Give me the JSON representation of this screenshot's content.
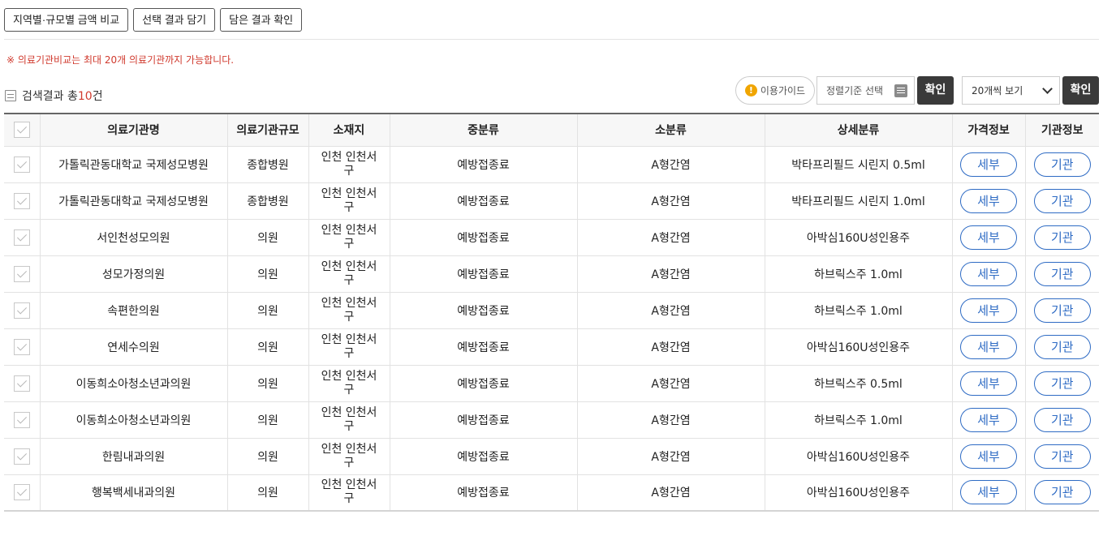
{
  "top_buttons": [
    "지역별·규모별 금액 비교",
    "선택 결과 담기",
    "담은 결과 확인"
  ],
  "notice": "※ 의료기관비교는 최대 20개 의료기관까지 가능합니다.",
  "result": {
    "prefix": "검색결과 총",
    "count": "10",
    "suffix": "건"
  },
  "toolbar": {
    "guide_label": "이용가이드",
    "guide_icon_glyph": "!",
    "sort_placeholder": "정렬기준 선택",
    "confirm_label": "확인",
    "page_size_value": "20개씩 보기"
  },
  "table": {
    "columns": [
      "의료기관명",
      "의료기관규모",
      "소재지",
      "중분류",
      "소분류",
      "상세분류",
      "가격정보",
      "기관정보"
    ],
    "rows": [
      {
        "name": "가톨릭관동대학교 국제성모병원",
        "size": "종합병원",
        "location": "인천 인천서구",
        "mid": "예방접종료",
        "sub": "A형간염",
        "detail": "박타프리필드 시린지 0.5ml",
        "price_btn": "세부",
        "inst_btn": "기관"
      },
      {
        "name": "가톨릭관동대학교 국제성모병원",
        "size": "종합병원",
        "location": "인천 인천서구",
        "mid": "예방접종료",
        "sub": "A형간염",
        "detail": "박타프리필드 시린지 1.0ml",
        "price_btn": "세부",
        "inst_btn": "기관"
      },
      {
        "name": "서인천성모의원",
        "size": "의원",
        "location": "인천 인천서구",
        "mid": "예방접종료",
        "sub": "A형간염",
        "detail": "아박심160U성인용주",
        "price_btn": "세부",
        "inst_btn": "기관"
      },
      {
        "name": "성모가정의원",
        "size": "의원",
        "location": "인천 인천서구",
        "mid": "예방접종료",
        "sub": "A형간염",
        "detail": "하브릭스주 1.0ml",
        "price_btn": "세부",
        "inst_btn": "기관"
      },
      {
        "name": "속편한의원",
        "size": "의원",
        "location": "인천 인천서구",
        "mid": "예방접종료",
        "sub": "A형간염",
        "detail": "하브릭스주 1.0ml",
        "price_btn": "세부",
        "inst_btn": "기관"
      },
      {
        "name": "연세수의원",
        "size": "의원",
        "location": "인천 인천서구",
        "mid": "예방접종료",
        "sub": "A형간염",
        "detail": "아박심160U성인용주",
        "price_btn": "세부",
        "inst_btn": "기관"
      },
      {
        "name": "이동희소아청소년과의원",
        "size": "의원",
        "location": "인천 인천서구",
        "mid": "예방접종료",
        "sub": "A형간염",
        "detail": "하브릭스주 0.5ml",
        "price_btn": "세부",
        "inst_btn": "기관"
      },
      {
        "name": "이동희소아청소년과의원",
        "size": "의원",
        "location": "인천 인천서구",
        "mid": "예방접종료",
        "sub": "A형간염",
        "detail": "하브릭스주 1.0ml",
        "price_btn": "세부",
        "inst_btn": "기관"
      },
      {
        "name": "한림내과의원",
        "size": "의원",
        "location": "인천 인천서구",
        "mid": "예방접종료",
        "sub": "A형간염",
        "detail": "아박심160U성인용주",
        "price_btn": "세부",
        "inst_btn": "기관"
      },
      {
        "name": "행복백세내과의원",
        "size": "의원",
        "location": "인천 인천서구",
        "mid": "예방접종료",
        "sub": "A형간염",
        "detail": "아박심160U성인용주",
        "price_btn": "세부",
        "inst_btn": "기관"
      }
    ]
  },
  "colors": {
    "accent_red": "#d03a2e",
    "link_blue": "#2e6bc4",
    "dark_button": "#3a3a3a",
    "info_orange": "#f0a500"
  }
}
